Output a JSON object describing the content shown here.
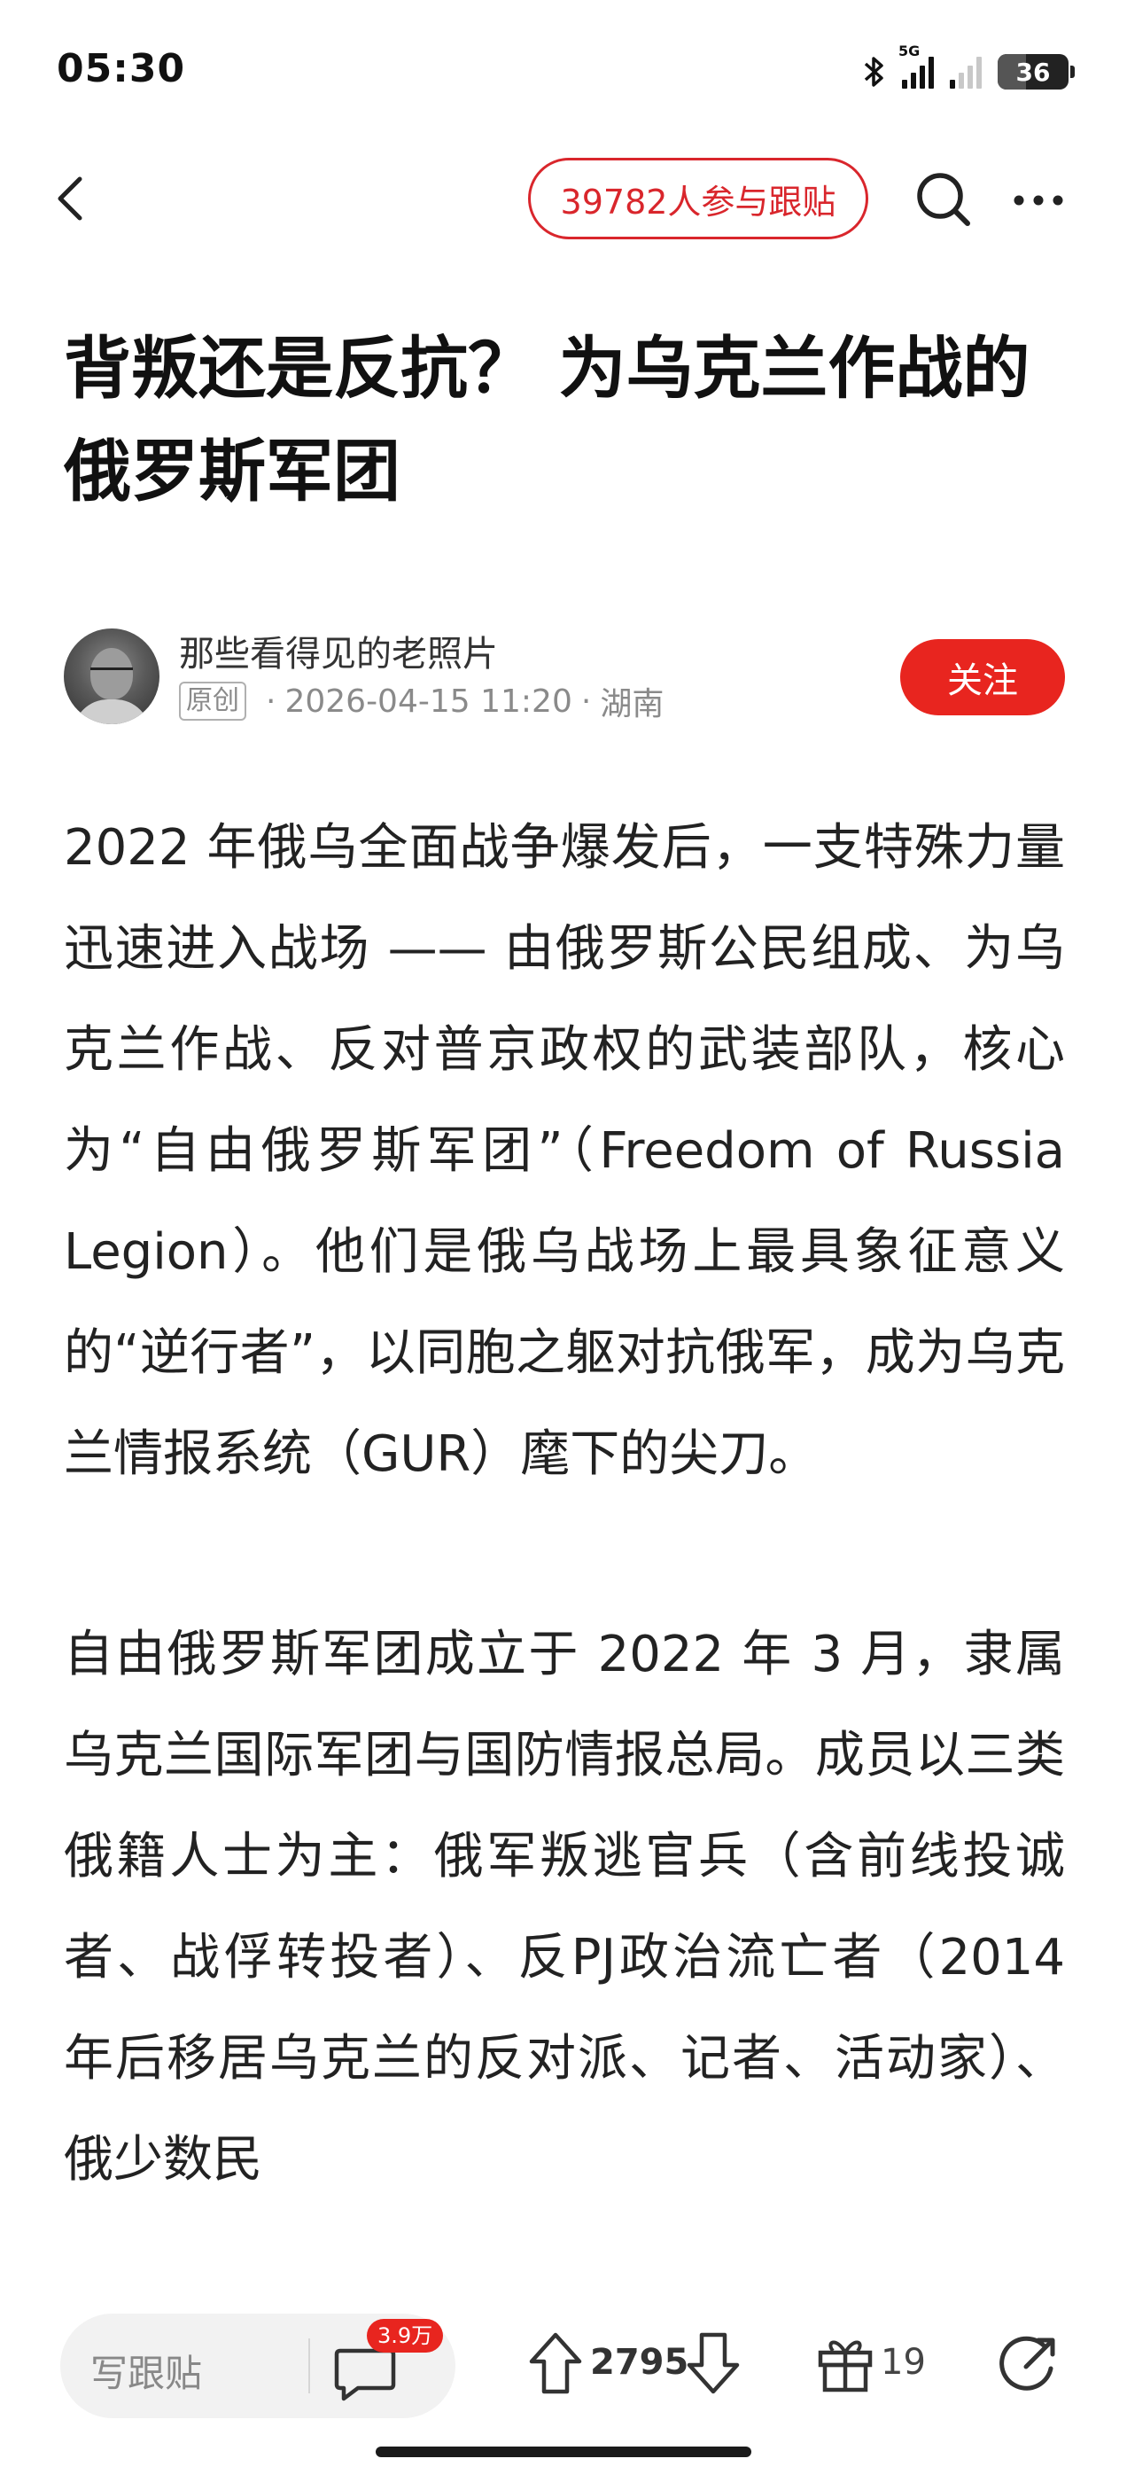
{
  "status_bar": {
    "time": "05:30",
    "network_label": "5G",
    "battery": "36",
    "icons": [
      "bluetooth-icon",
      "signal-icon",
      "signal-weak-icon",
      "battery-icon"
    ]
  },
  "nav": {
    "participants_label": "39782人参与跟贴",
    "icons": [
      "back-icon",
      "search-icon",
      "more-icon"
    ],
    "accent_color": "#d9262c"
  },
  "article": {
    "title": "背叛还是反抗？ 为乌克兰作战的俄罗斯军团",
    "author": {
      "name": "那些看得见的老照片",
      "badge": "原创",
      "date": "2026-04-15 11:20",
      "location": "湖南",
      "follow_label": "关注"
    },
    "paragraphs": [
      "2022 年俄乌全面战争爆发后，一支特殊力量迅速进入战场 —— 由俄罗斯公民组成、为乌克兰作战、反对普京政权的武装部队，核心为“自由俄罗斯军团”（Freedom of Russia Legion）。他们是俄乌战场上最具象征意义的“逆行者”，以同胞之躯对抗俄军，成为乌克兰情报系统（GUR）麾下的尖刀。",
      "自由俄罗斯军团成立于 2022 年 3 月，隶属乌克兰国际军团与国防情报总局。成员以三类俄籍人士为主：俄军叛逃官兵（含前线投诚者、战俘转投者）、反PJ政治流亡者（2014 年后移居乌克兰的反对派、记者、活动家）、俄少数民"
    ]
  },
  "bottom_bar": {
    "comment_placeholder": "写跟贴",
    "comment_count": "3.9万",
    "upvotes": "2795",
    "gifts": "19",
    "badge_color": "#e8251f"
  }
}
